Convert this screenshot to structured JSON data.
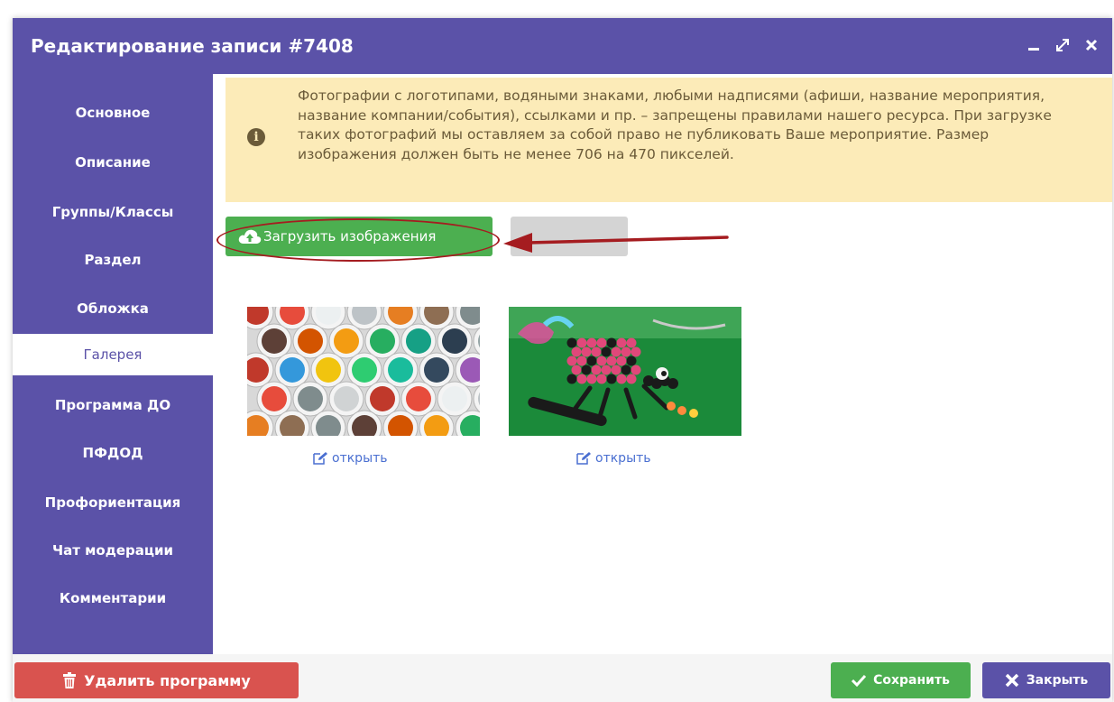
{
  "window": {
    "title": "Редактирование записи #7408",
    "controls": [
      "minimize-icon",
      "expand-icon",
      "close-icon"
    ]
  },
  "sidebar": {
    "items": [
      {
        "label": "Основное"
      },
      {
        "label": "Описание"
      },
      {
        "label": "Группы/Классы"
      },
      {
        "label": "Раздел"
      },
      {
        "label": "Обложка"
      },
      {
        "label": "Галерея",
        "active": true
      },
      {
        "label": "Программа ДО"
      },
      {
        "label": "ПФДОД"
      },
      {
        "label": "Профориентация"
      },
      {
        "label": "Чат модерации"
      },
      {
        "label": "Комментарии"
      }
    ]
  },
  "alert": {
    "icon": "info-icon",
    "text": "Фотографии с логотипами, водяными знаками, любыми надписями (афиши, название мероприятия, название компании/события), ссылками и пр. – запрещены правилами нашего ресурса. При загрузке таких фотографий мы оставляем за собой право не публиковать Ваше мероприятие. Размер изображения должен быть не менее 706 на 470 пикселей."
  },
  "gallery": {
    "upload_label": "Загрузить изображения",
    "upload_icon": "cloud-upload-icon",
    "images": [
      {
        "subject": "beads-containers",
        "open_label": "открыть"
      },
      {
        "subject": "beaded-ladybug",
        "open_label": "открыть"
      }
    ]
  },
  "footer": {
    "delete_label": "Удалить программу",
    "save_label": "Сохранить",
    "close_label": "Закрыть"
  },
  "colors": {
    "primary": "#5b52a8",
    "success": "#4caf50",
    "danger": "#d9534f",
    "alert_bg": "#fcebb8",
    "annotation": "#a51c20"
  }
}
